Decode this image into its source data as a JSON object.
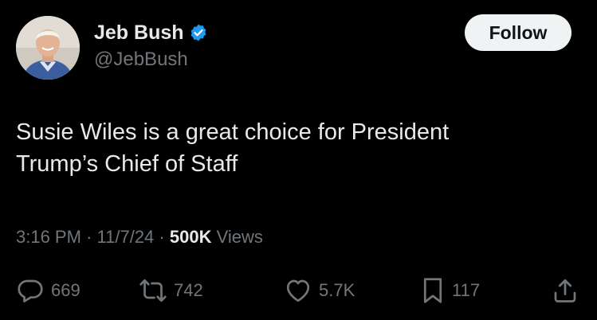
{
  "author": {
    "display_name": "Jeb Bush",
    "handle": "@JebBush",
    "verified_icon": "verified-badge-icon",
    "verified_color": "#1d9bf0"
  },
  "follow_label": "Follow",
  "tweet": {
    "text_line1": "Susie Wiles is a great choice for President",
    "text_line2": "Trump’s Chief of Staff"
  },
  "meta": {
    "time": "3:16 PM",
    "sep1": "·",
    "date": "11/7/24",
    "sep2": "·",
    "views_count": "500K",
    "views_label": "Views"
  },
  "actions": {
    "replies": "669",
    "reposts": "742",
    "likes": "5.7K",
    "bookmarks": "117"
  },
  "colors": {
    "background": "#000000",
    "primary_text": "#e7e9ea",
    "secondary_text": "#71767b",
    "follow_bg": "#eff3f4",
    "follow_text": "#0f1419"
  }
}
